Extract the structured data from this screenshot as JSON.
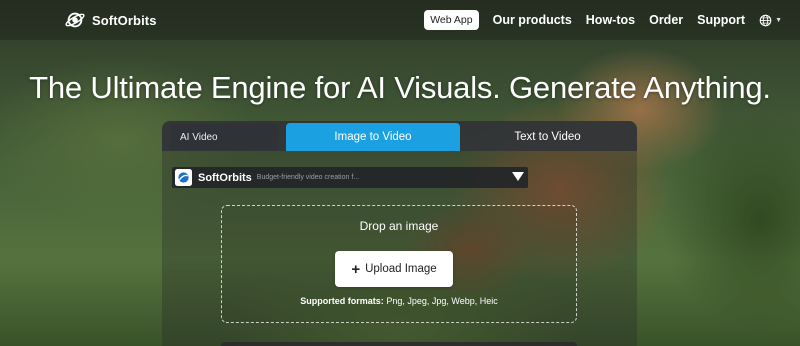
{
  "nav": {
    "brand": "SoftOrbits",
    "web_app": "Web App",
    "links": [
      "Our products",
      "How-tos",
      "Order",
      "Support"
    ],
    "lang_icon": "globe-icon"
  },
  "hero": {
    "headline": "The Ultimate Engine for AI Visuals. Generate Anything."
  },
  "tabs": {
    "ai_video": "AI Video",
    "image_to_video": "Image to Video",
    "text_to_video": "Text to Video",
    "active": "Image to Video"
  },
  "model": {
    "name": "SoftOrbits",
    "description": "Budget-friendly video creation f..."
  },
  "upload": {
    "title": "Drop an image",
    "button": "Upload Image",
    "formats_label": "Supported formats:",
    "formats_value": "Png, Jpeg, Jpg, Webp, Heic"
  },
  "colors": {
    "accent": "#1ba1e2",
    "nav_bg": "#141612"
  }
}
